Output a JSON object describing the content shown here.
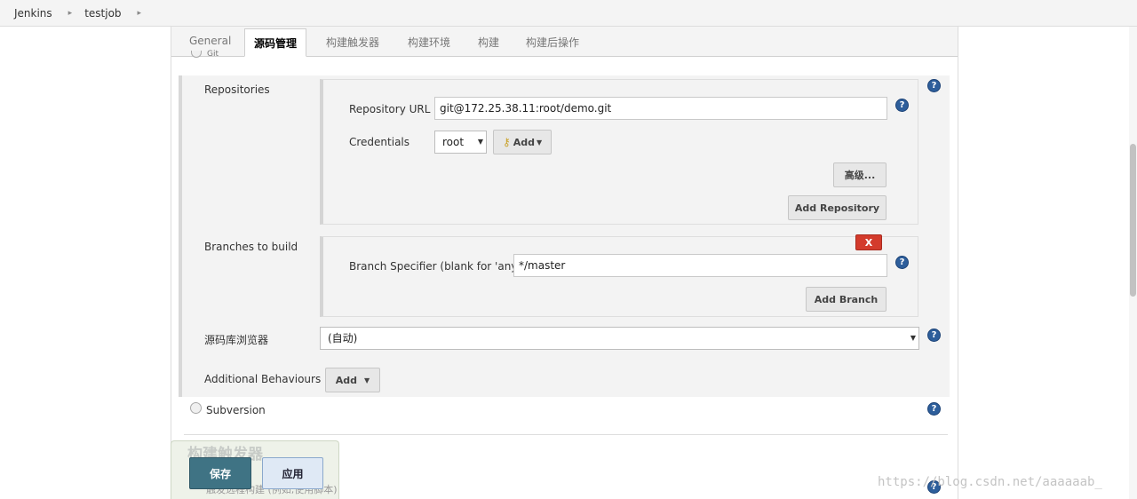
{
  "breadcrumb": [
    "Jenkins",
    "testjob"
  ],
  "tabs": [
    "General",
    "源码管理",
    "构建触发器",
    "构建环境",
    "构建",
    "构建后操作"
  ],
  "active_tab": "源码管理",
  "git_option_label": "Git",
  "repositories": {
    "label": "Repositories",
    "url_label": "Repository URL",
    "url_value": "git@172.25.38.11:root/demo.git",
    "credentials_label": "Credentials",
    "credentials_value": "root",
    "add_label": "Add",
    "advanced_label": "高级...",
    "add_repository_label": "Add Repository"
  },
  "branches": {
    "label": "Branches to build",
    "delete_label": "X",
    "specifier_label": "Branch Specifier (blank for 'any')",
    "specifier_value": "*/master",
    "add_branch_label": "Add Branch"
  },
  "browser": {
    "label": "源码库浏览器",
    "value": "(自动)"
  },
  "behaviours": {
    "label": "Additional Behaviours",
    "add_label": "Add"
  },
  "subversion_label": "Subversion",
  "next_section_heading": "构建触发器",
  "next_section_text": "触发远程构建 (例如,使用脚本)",
  "save_label": "保存",
  "apply_label": "应用",
  "watermark": "https://blog.csdn.net/aaaaaab_",
  "colors": {
    "save": "#3f7384",
    "apply": "#dfe9f5",
    "help": "#2d5e9b",
    "delete": "#d33b2c"
  },
  "icons": [
    "help-icon",
    "key-icon",
    "dropdown-arrow-icon",
    "breadcrumb-arrow-icon"
  ]
}
